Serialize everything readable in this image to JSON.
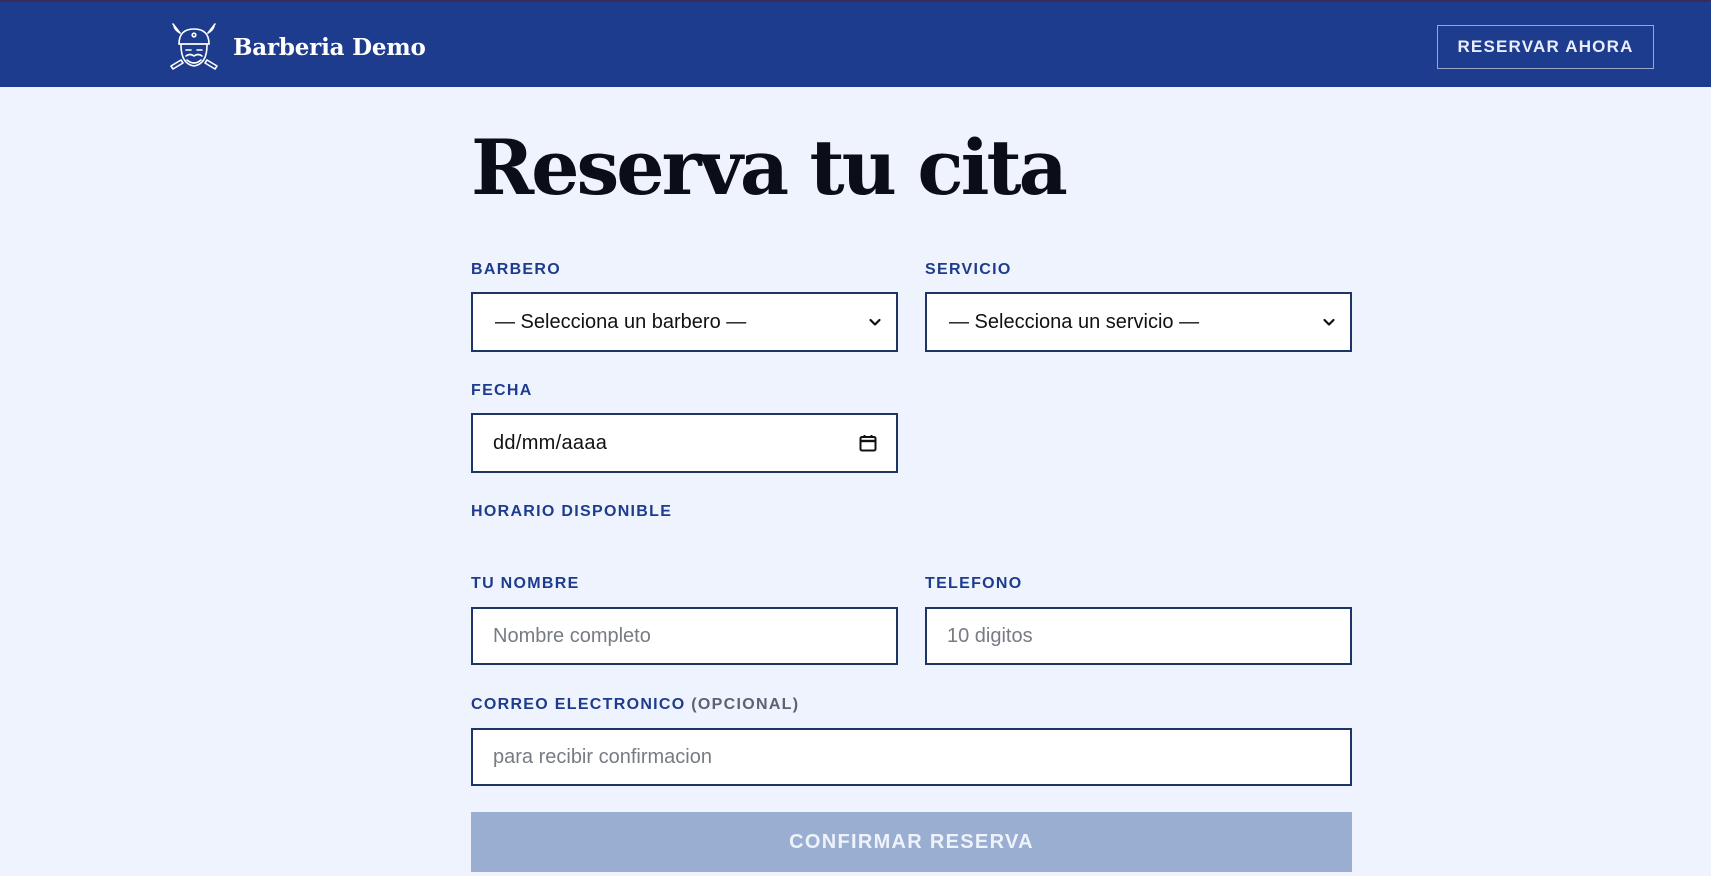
{
  "header": {
    "brand_name": "Barberia Demo",
    "logo_icon": "viking-barber-logo-icon",
    "cta_label": "RESERVAR AHORA"
  },
  "main": {
    "title": "Reserva tu cita",
    "barber": {
      "label": "BARBERO",
      "value": "— Selecciona un barbero —"
    },
    "service": {
      "label": "SERVICIO",
      "value": "— Selecciona un servicio —"
    },
    "date": {
      "label": "FECHA",
      "value": "dd/mm/aaaa"
    },
    "schedule": {
      "label": "HORARIO DISPONIBLE"
    },
    "name": {
      "label": "TU NOMBRE",
      "placeholder": "Nombre completo"
    },
    "phone": {
      "label": "TELEFONO",
      "placeholder": "10 digitos"
    },
    "email": {
      "label": "CORREO ELECTRONICO",
      "label_suffix": "(OPCIONAL)",
      "placeholder": "para recibir confirmacion"
    },
    "submit_label": "CONFIRMAR RESERVA"
  },
  "colors": {
    "header_bg": "#1d3c8d",
    "page_bg": "#eef3fe",
    "label_accent": "#1d3c8d",
    "field_border": "#1f3566",
    "submit_disabled_bg": "#9aaed1"
  }
}
